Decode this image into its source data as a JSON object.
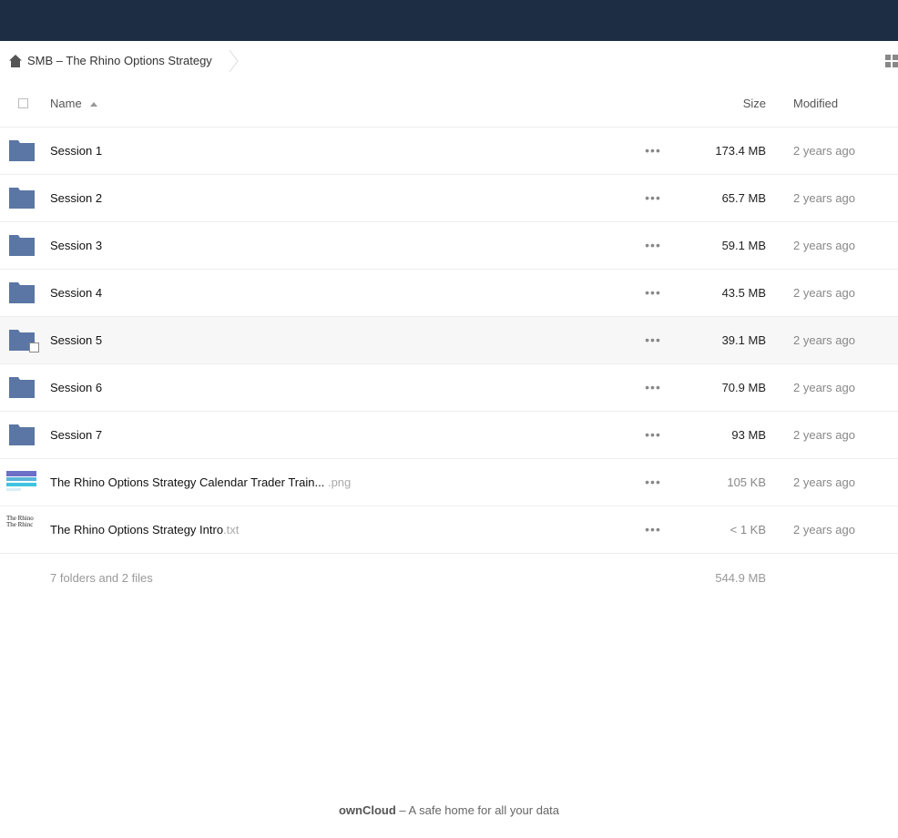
{
  "breadcrumb": {
    "home_icon": "home-icon",
    "current": "SMB – The Rhino Options Strategy"
  },
  "view_toggle_icon": "grid-icon",
  "columns": {
    "name": "Name",
    "size": "Size",
    "modified": "Modified"
  },
  "files": [
    {
      "name": "Session 1",
      "ext": "",
      "type": "folder",
      "size": "173.4 MB",
      "modified": "2 years ago"
    },
    {
      "name": "Session 2",
      "ext": "",
      "type": "folder",
      "size": "65.7 MB",
      "modified": "2 years ago"
    },
    {
      "name": "Session 3",
      "ext": "",
      "type": "folder",
      "size": "59.1 MB",
      "modified": "2 years ago"
    },
    {
      "name": "Session 4",
      "ext": "",
      "type": "folder",
      "size": "43.5 MB",
      "modified": "2 years ago"
    },
    {
      "name": "Session 5",
      "ext": "",
      "type": "folder",
      "size": "39.1 MB",
      "modified": "2 years ago"
    },
    {
      "name": "Session 6",
      "ext": "",
      "type": "folder",
      "size": "70.9 MB",
      "modified": "2 years ago"
    },
    {
      "name": "Session 7",
      "ext": "",
      "type": "folder",
      "size": "93 MB",
      "modified": "2 years ago"
    },
    {
      "name": "The Rhino Options Strategy Calendar Trader Train...",
      "ext": ".png",
      "type": "image",
      "size": "105 KB",
      "modified": "2 years ago"
    },
    {
      "name": "The Rhino Options Strategy Intro",
      "ext": ".txt",
      "type": "text",
      "size": "< 1 KB",
      "modified": "2 years ago"
    }
  ],
  "txt_preview": [
    "The Rhino",
    "The Rhinc"
  ],
  "actions_glyph": "•••",
  "summary": {
    "count": "7 folders and 2 files",
    "total": "544.9 MB"
  },
  "footer": {
    "brand": "ownCloud",
    "tagline": " – A safe home for all your data"
  },
  "colors": {
    "topbar": "#1d2d44",
    "folder": "#5b76a4"
  }
}
